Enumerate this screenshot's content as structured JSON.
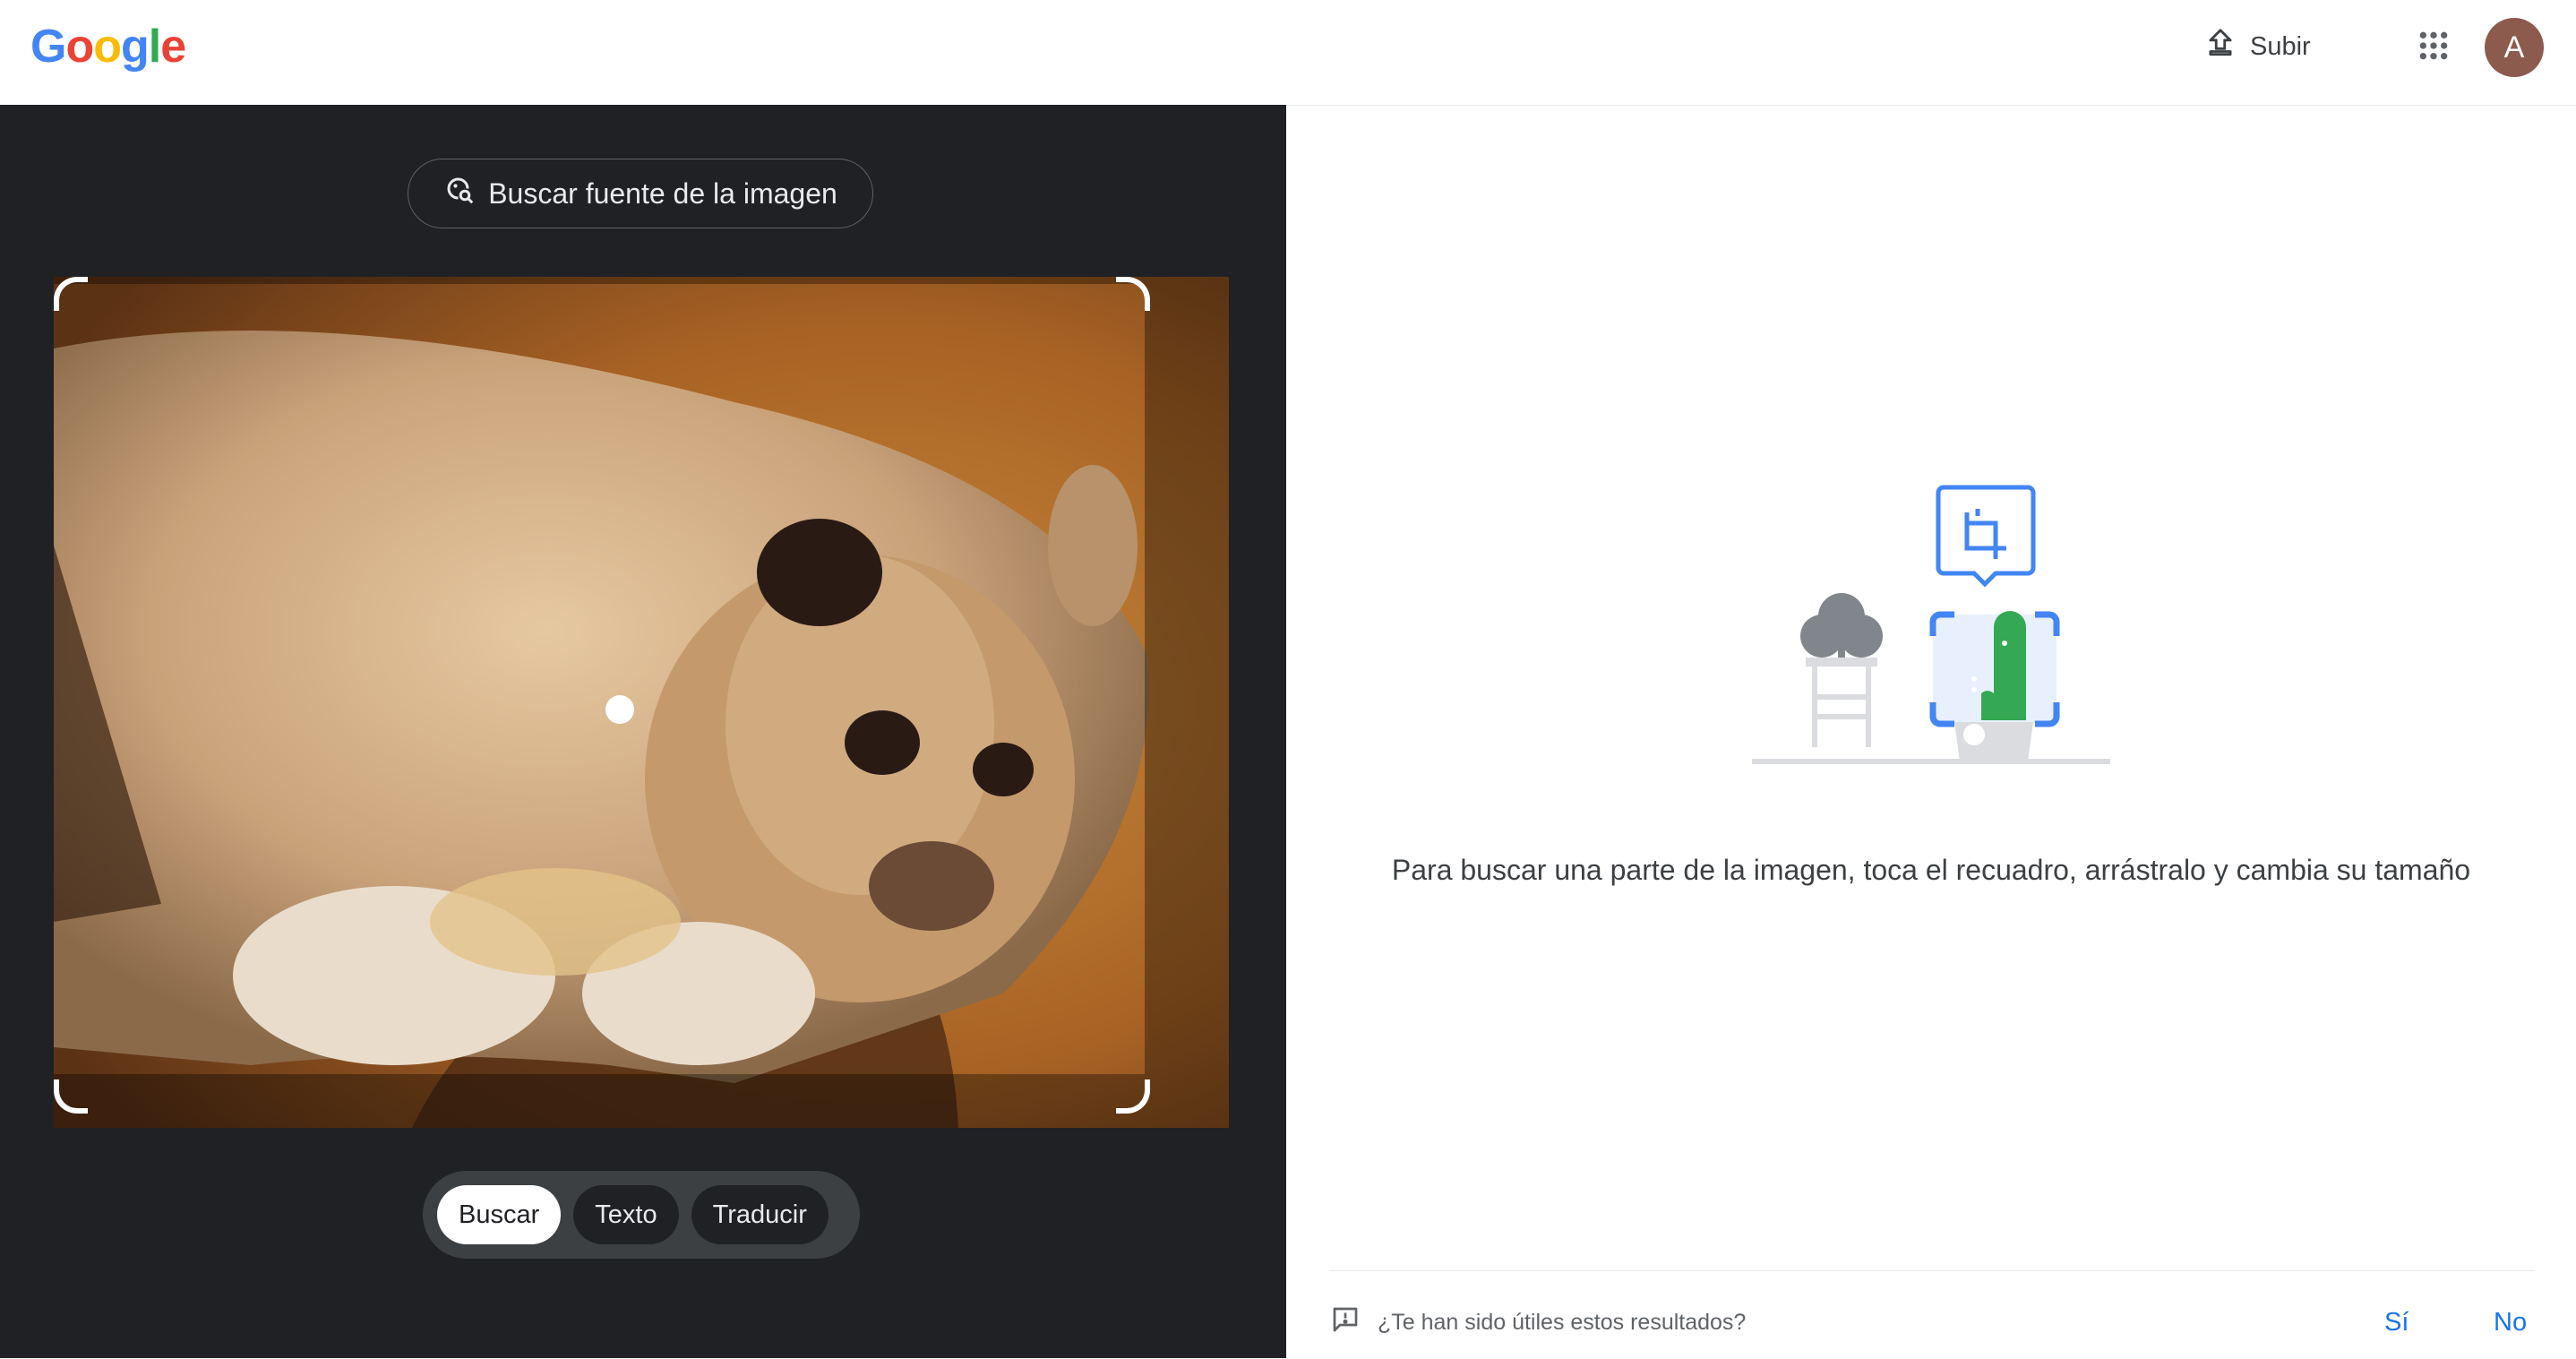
{
  "header": {
    "logo_letters": [
      {
        "ch": "G",
        "color": "#4285F4"
      },
      {
        "ch": "o",
        "color": "#EA4335"
      },
      {
        "ch": "o",
        "color": "#FBBC05"
      },
      {
        "ch": "g",
        "color": "#4285F4"
      },
      {
        "ch": "l",
        "color": "#34A853"
      },
      {
        "ch": "e",
        "color": "#EA4335"
      }
    ],
    "upload_label": "Subir",
    "upload_icon": "upload-icon",
    "apps_icon": "apps-grid-icon",
    "avatar_letter": "A",
    "avatar_color": "#8d5a4e"
  },
  "lens": {
    "source_button_label": "Buscar fuente de la imagen",
    "source_button_icon": "image-search-icon",
    "image_subject": "lion cub",
    "modes": [
      {
        "label": "Buscar",
        "active": true
      },
      {
        "label": "Texto",
        "active": false
      },
      {
        "label": "Traducir",
        "active": false
      }
    ]
  },
  "results": {
    "illustration_icon": "crop-icon",
    "hint": "Para buscar una parte de la imagen, toca el recuadro, arrástralo y cambia su tamaño",
    "feedback_icon": "feedback-icon",
    "feedback_question": "¿Te han sido útiles estos resultados?",
    "feedback_yes": "Sí",
    "feedback_no": "No"
  },
  "colors": {
    "accent": "#1a73e8",
    "dark_panel": "#202124",
    "plant_green": "#34a853"
  }
}
